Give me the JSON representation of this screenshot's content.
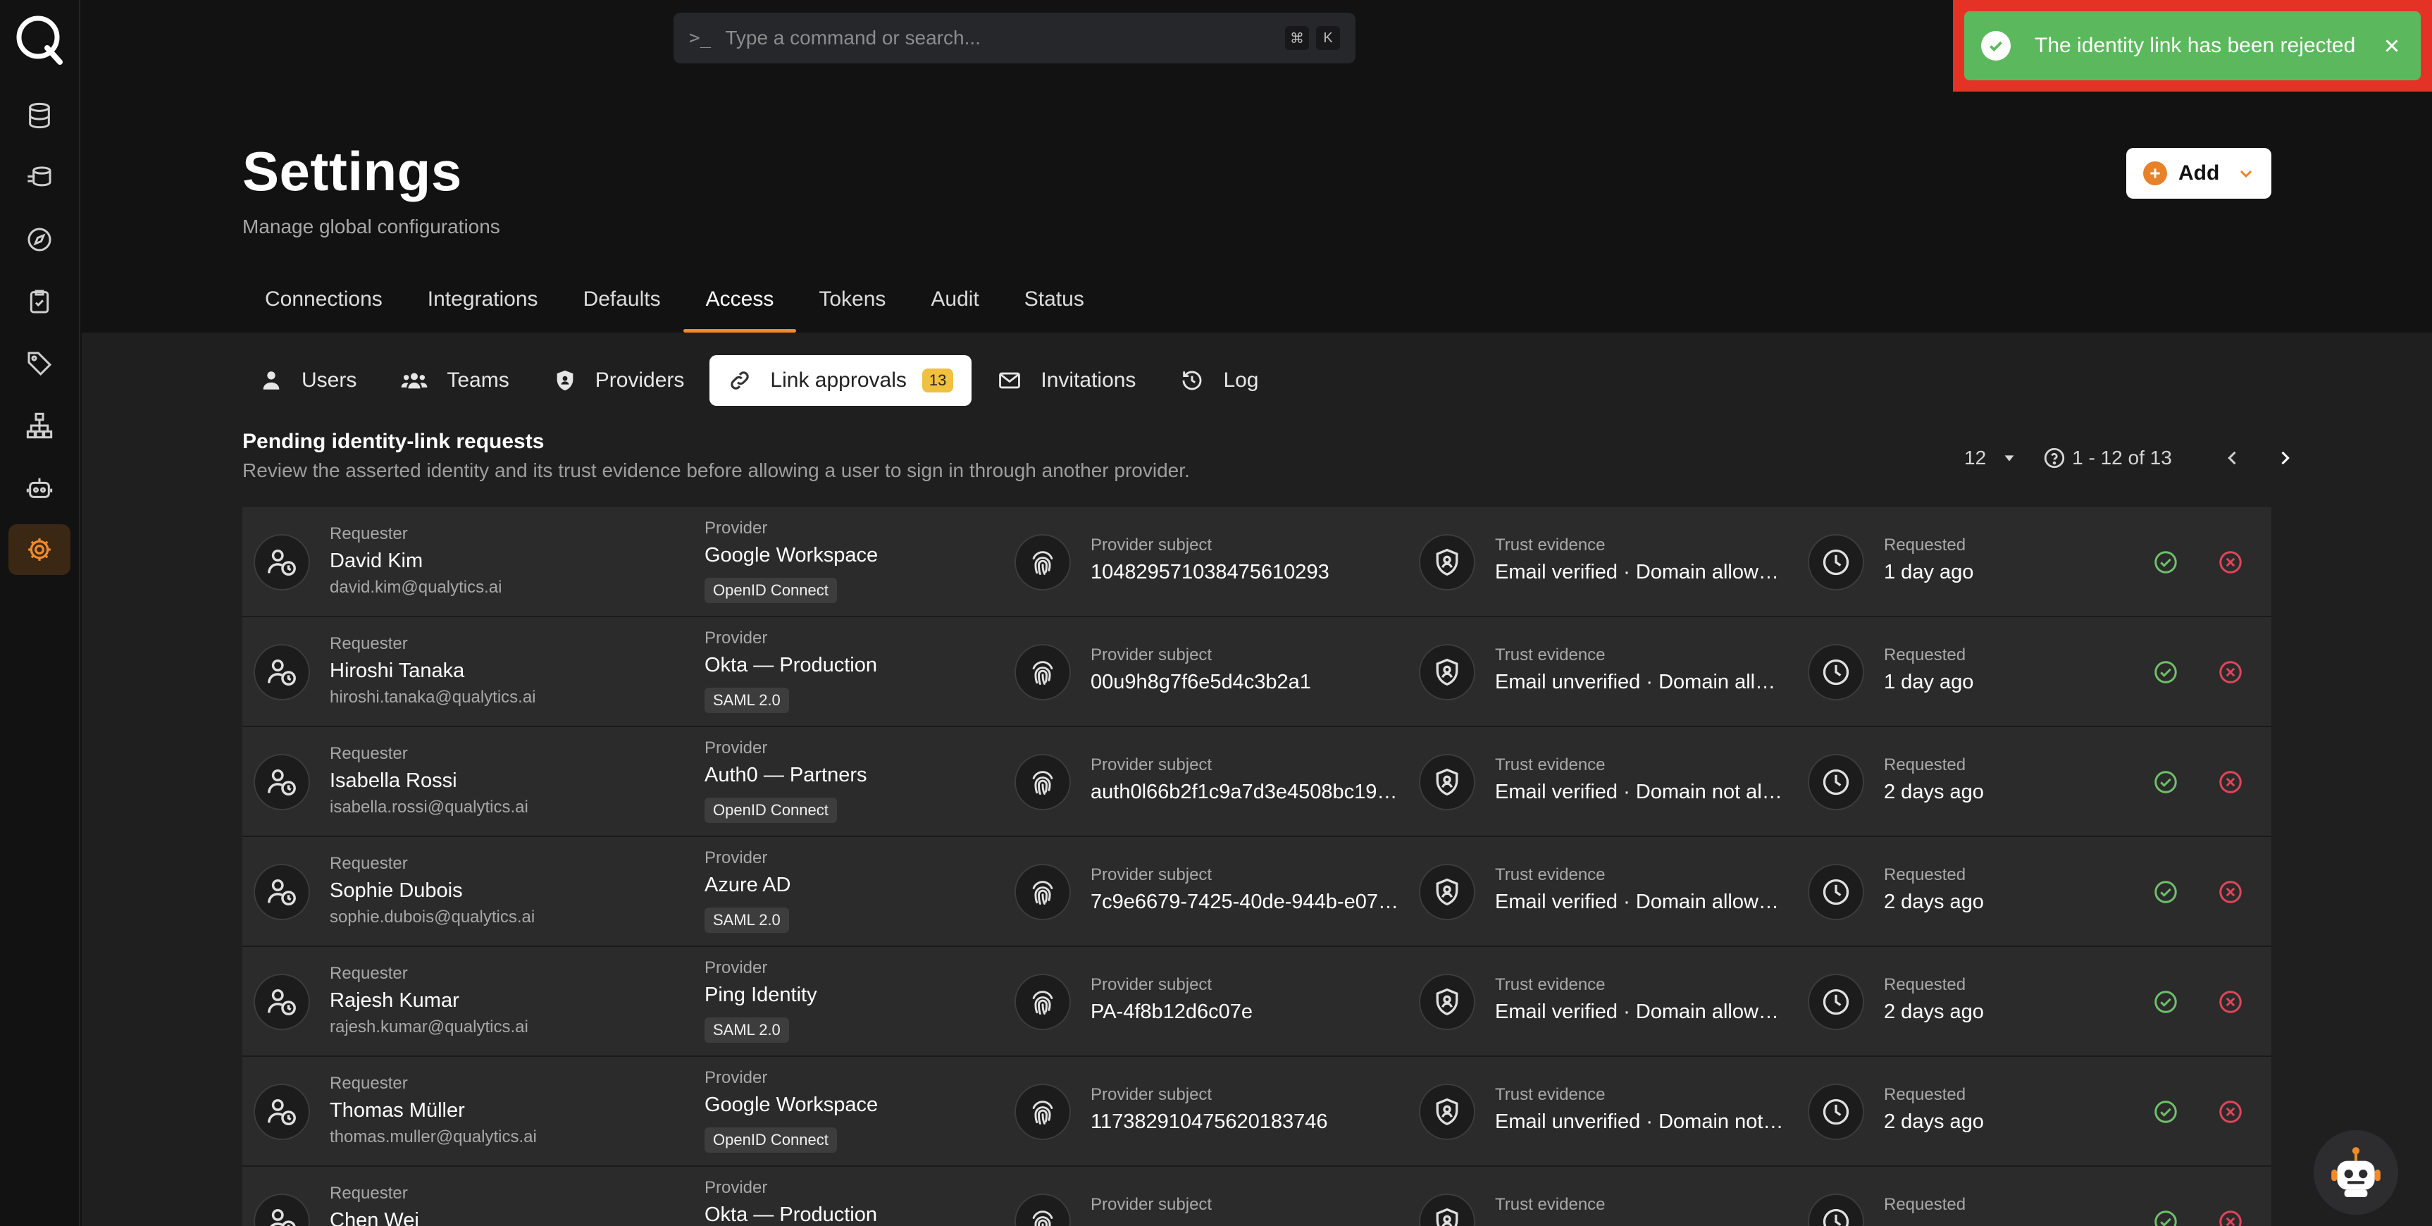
{
  "command_bar": {
    "placeholder": "Type a command or search...",
    "key1": "⌘",
    "key2": "K"
  },
  "toast": {
    "message": "The identity link has been rejected"
  },
  "header": {
    "title": "Settings",
    "subtitle": "Manage global configurations",
    "add_label": "Add"
  },
  "tabs": [
    {
      "label": "Connections"
    },
    {
      "label": "Integrations"
    },
    {
      "label": "Defaults"
    },
    {
      "label": "Access",
      "active": true
    },
    {
      "label": "Tokens"
    },
    {
      "label": "Audit"
    },
    {
      "label": "Status"
    }
  ],
  "subtabs": {
    "users": "Users",
    "teams": "Teams",
    "providers": "Providers",
    "link_approvals": "Link approvals",
    "link_count": "13",
    "invitations": "Invitations",
    "log": "Log"
  },
  "section": {
    "title": "Pending identity-link requests",
    "description": "Review the asserted identity and its trust evidence before allowing a user to sign in through another provider."
  },
  "pagination": {
    "per_page": "12",
    "range": "1 - 12 of 13"
  },
  "columns": {
    "requester": "Requester",
    "provider": "Provider",
    "subject": "Provider subject",
    "trust": "Trust evidence",
    "requested": "Requested"
  },
  "rows": [
    {
      "name": "David Kim",
      "email": "david.kim@qualytics.ai",
      "provider": "Google Workspace",
      "protocol": "OpenID Connect",
      "subject": "104829571038475610293",
      "trust": "Email verified · Domain allowed …",
      "requested": "1 day ago"
    },
    {
      "name": "Hiroshi Tanaka",
      "email": "hiroshi.tanaka@qualytics.ai",
      "provider": "Okta — Production",
      "protocol": "SAML 2.0",
      "subject": "00u9h8g7f6e5d4c3b2a1",
      "trust": "Email unverified · Domain allow…",
      "requested": "1 day ago"
    },
    {
      "name": "Isabella Rossi",
      "email": "isabella.rossi@qualytics.ai",
      "provider": "Auth0 — Partners",
      "protocol": "OpenID Connect",
      "subject": "auth0l66b2f1c9a7d3e4508bc19f…",
      "trust": "Email verified · Domain not allo…",
      "requested": "2 days ago"
    },
    {
      "name": "Sophie Dubois",
      "email": "sophie.dubois@qualytics.ai",
      "provider": "Azure AD",
      "protocol": "SAML 2.0",
      "subject": "7c9e6679-7425-40de-944b-e07…",
      "trust": "Email verified · Domain allowed …",
      "requested": "2 days ago"
    },
    {
      "name": "Rajesh Kumar",
      "email": "rajesh.kumar@qualytics.ai",
      "provider": "Ping Identity",
      "protocol": "SAML 2.0",
      "subject": "PA-4f8b12d6c07e",
      "trust": "Email verified · Domain allowed …",
      "requested": "2 days ago"
    },
    {
      "name": "Thomas Müller",
      "email": "thomas.muller@qualytics.ai",
      "provider": "Google Workspace",
      "protocol": "OpenID Connect",
      "subject": "117382910475620183746",
      "trust": "Email unverified · Domain not al…",
      "requested": "2 days ago"
    },
    {
      "name": "Chen Wei",
      "email": "",
      "provider": "Okta — Production",
      "protocol": "",
      "subject": "",
      "trust": "",
      "requested": ""
    }
  ],
  "colors": {
    "accent": "#f08a2c",
    "approve": "#6ec06a",
    "reject": "#e0455a",
    "toast_bg": "#5cb85c"
  },
  "icons": {
    "sidebar": [
      "database-icon",
      "flow-icon",
      "compass-icon",
      "clipboard-check-icon",
      "tag-icon",
      "hierarchy-icon",
      "robot-icon",
      "gear-icon"
    ]
  }
}
